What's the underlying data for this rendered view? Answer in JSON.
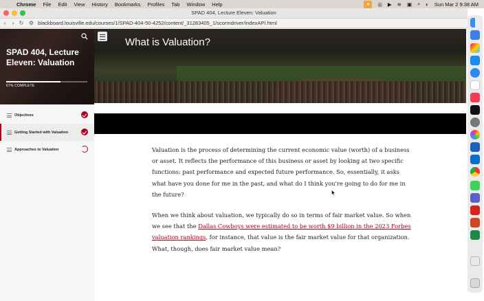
{
  "menubar": {
    "app": "Chrome",
    "items": [
      "File",
      "Edit",
      "View",
      "History",
      "Bookmarks",
      "Profiles",
      "Tab",
      "Window",
      "Help"
    ],
    "datetime": "Sun Mar 2  9:38 AM"
  },
  "browser": {
    "window_title": "SPAD 404, Lecture Eleven: Valuation",
    "url": "blackboard.louisville.edu/courses/1/SPAD-404-50-4252/content/_31283405_1/scormdriver/indexAPI.html"
  },
  "sidebar": {
    "course_title": "SPAD 404, Lecture Eleven: Valuation",
    "progress_percent": 67,
    "progress_label": "67% COMPLETE",
    "lessons": [
      {
        "label": "Objectives",
        "status": "complete"
      },
      {
        "label": "Getting Started with Valuation",
        "status": "complete"
      },
      {
        "label": "Approaches to Valuation",
        "status": "in-progress"
      }
    ]
  },
  "main": {
    "title": "What is Valuation?",
    "paragraph1": "Valuation is the process of determining the current economic value (worth) of a business or asset. It reflects the performance of this business or asset by looking at two specific functions: past performance and expected future performance. So, essentially, it asks what have you done for me in the past, and what do I think you're going to do for me in the future?",
    "paragraph2_before": "When we think about valuation, we typically do so in terms of fair market value. So when we see that the ",
    "paragraph2_link": "Dallas Cowboys were estimated to be worth $9 billion in the 2023 Forbes valuation rankings",
    "paragraph2_after": ", for instance, that value is the fair market value for that organization. What, though, does fair market value mean?"
  },
  "colors": {
    "accent": "#ad0021",
    "link": "#a8001c",
    "black_band": "#000000"
  },
  "dock": {
    "icons": [
      "finder-icon",
      "safari-icon",
      "launchpad-icon",
      "app-store-icon",
      "calendar-icon",
      "music-icon",
      "apple-tv-icon",
      "settings-icon",
      "photos-icon",
      "word-icon",
      "outlook-icon",
      "chrome-icon",
      "messages-icon",
      "teams-icon",
      "acrobat-icon",
      "powerpoint-icon",
      "excel-icon",
      "downloads-icon",
      "trash-icon"
    ]
  }
}
